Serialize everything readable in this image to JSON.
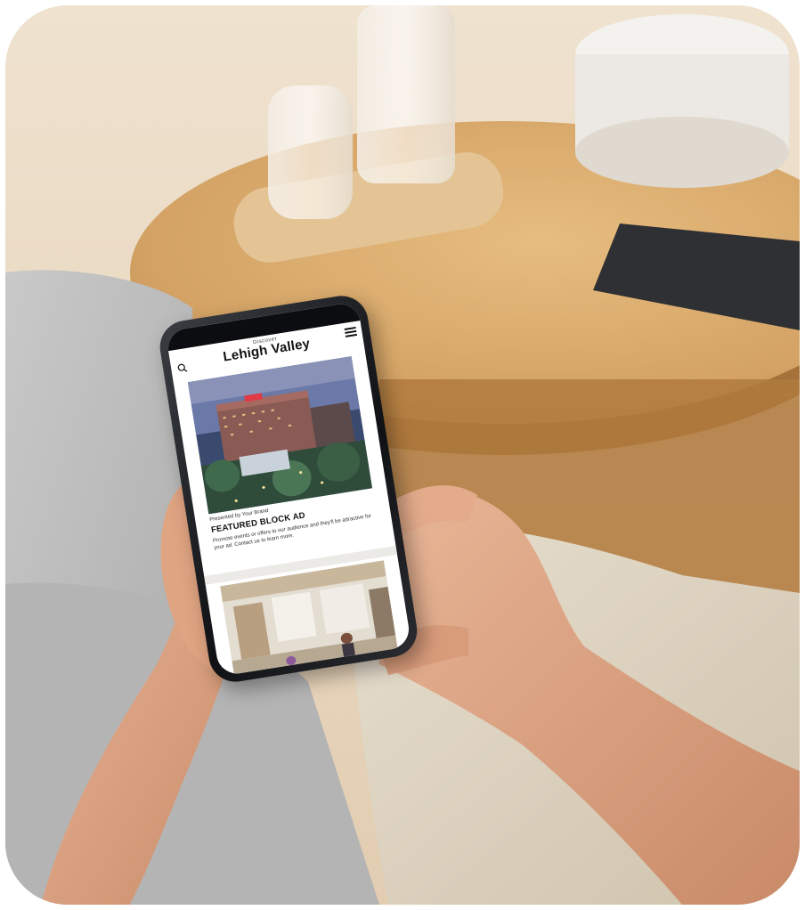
{
  "app": {
    "brand_eyebrow": "Discover",
    "brand_title": "Lehigh Valley",
    "icons": {
      "search": "search-icon",
      "menu": "hamburger-menu-icon"
    }
  },
  "featured_ad": {
    "sponsor_line": "Presented by Your Brand",
    "heading": "FEATURED BLOCK AD",
    "body": "Promote events or offers to our audience and they'll be attractive for your ad. Contact us to learn more."
  },
  "colors": {
    "brand_text": "#111111",
    "screen_background": "#ffffff",
    "table_wood": "#d7a86b"
  }
}
